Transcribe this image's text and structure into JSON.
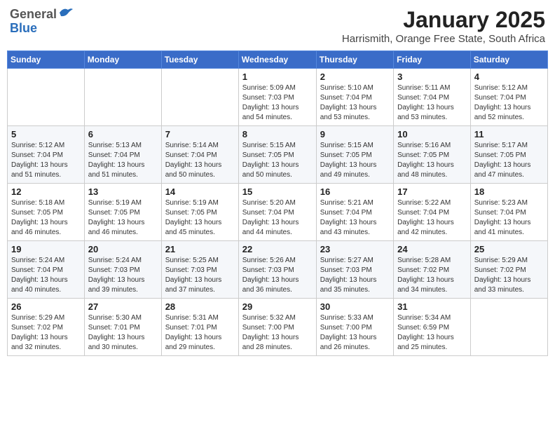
{
  "header": {
    "logo_general": "General",
    "logo_blue": "Blue",
    "month_title": "January 2025",
    "location": "Harrismith, Orange Free State, South Africa"
  },
  "weekdays": [
    "Sunday",
    "Monday",
    "Tuesday",
    "Wednesday",
    "Thursday",
    "Friday",
    "Saturday"
  ],
  "weeks": [
    [
      {
        "day": "",
        "info": ""
      },
      {
        "day": "",
        "info": ""
      },
      {
        "day": "",
        "info": ""
      },
      {
        "day": "1",
        "info": "Sunrise: 5:09 AM\nSunset: 7:03 PM\nDaylight: 13 hours\nand 54 minutes."
      },
      {
        "day": "2",
        "info": "Sunrise: 5:10 AM\nSunset: 7:04 PM\nDaylight: 13 hours\nand 53 minutes."
      },
      {
        "day": "3",
        "info": "Sunrise: 5:11 AM\nSunset: 7:04 PM\nDaylight: 13 hours\nand 53 minutes."
      },
      {
        "day": "4",
        "info": "Sunrise: 5:12 AM\nSunset: 7:04 PM\nDaylight: 13 hours\nand 52 minutes."
      }
    ],
    [
      {
        "day": "5",
        "info": "Sunrise: 5:12 AM\nSunset: 7:04 PM\nDaylight: 13 hours\nand 51 minutes."
      },
      {
        "day": "6",
        "info": "Sunrise: 5:13 AM\nSunset: 7:04 PM\nDaylight: 13 hours\nand 51 minutes."
      },
      {
        "day": "7",
        "info": "Sunrise: 5:14 AM\nSunset: 7:04 PM\nDaylight: 13 hours\nand 50 minutes."
      },
      {
        "day": "8",
        "info": "Sunrise: 5:15 AM\nSunset: 7:05 PM\nDaylight: 13 hours\nand 50 minutes."
      },
      {
        "day": "9",
        "info": "Sunrise: 5:15 AM\nSunset: 7:05 PM\nDaylight: 13 hours\nand 49 minutes."
      },
      {
        "day": "10",
        "info": "Sunrise: 5:16 AM\nSunset: 7:05 PM\nDaylight: 13 hours\nand 48 minutes."
      },
      {
        "day": "11",
        "info": "Sunrise: 5:17 AM\nSunset: 7:05 PM\nDaylight: 13 hours\nand 47 minutes."
      }
    ],
    [
      {
        "day": "12",
        "info": "Sunrise: 5:18 AM\nSunset: 7:05 PM\nDaylight: 13 hours\nand 46 minutes."
      },
      {
        "day": "13",
        "info": "Sunrise: 5:19 AM\nSunset: 7:05 PM\nDaylight: 13 hours\nand 46 minutes."
      },
      {
        "day": "14",
        "info": "Sunrise: 5:19 AM\nSunset: 7:05 PM\nDaylight: 13 hours\nand 45 minutes."
      },
      {
        "day": "15",
        "info": "Sunrise: 5:20 AM\nSunset: 7:04 PM\nDaylight: 13 hours\nand 44 minutes."
      },
      {
        "day": "16",
        "info": "Sunrise: 5:21 AM\nSunset: 7:04 PM\nDaylight: 13 hours\nand 43 minutes."
      },
      {
        "day": "17",
        "info": "Sunrise: 5:22 AM\nSunset: 7:04 PM\nDaylight: 13 hours\nand 42 minutes."
      },
      {
        "day": "18",
        "info": "Sunrise: 5:23 AM\nSunset: 7:04 PM\nDaylight: 13 hours\nand 41 minutes."
      }
    ],
    [
      {
        "day": "19",
        "info": "Sunrise: 5:24 AM\nSunset: 7:04 PM\nDaylight: 13 hours\nand 40 minutes."
      },
      {
        "day": "20",
        "info": "Sunrise: 5:24 AM\nSunset: 7:03 PM\nDaylight: 13 hours\nand 39 minutes."
      },
      {
        "day": "21",
        "info": "Sunrise: 5:25 AM\nSunset: 7:03 PM\nDaylight: 13 hours\nand 37 minutes."
      },
      {
        "day": "22",
        "info": "Sunrise: 5:26 AM\nSunset: 7:03 PM\nDaylight: 13 hours\nand 36 minutes."
      },
      {
        "day": "23",
        "info": "Sunrise: 5:27 AM\nSunset: 7:03 PM\nDaylight: 13 hours\nand 35 minutes."
      },
      {
        "day": "24",
        "info": "Sunrise: 5:28 AM\nSunset: 7:02 PM\nDaylight: 13 hours\nand 34 minutes."
      },
      {
        "day": "25",
        "info": "Sunrise: 5:29 AM\nSunset: 7:02 PM\nDaylight: 13 hours\nand 33 minutes."
      }
    ],
    [
      {
        "day": "26",
        "info": "Sunrise: 5:29 AM\nSunset: 7:02 PM\nDaylight: 13 hours\nand 32 minutes."
      },
      {
        "day": "27",
        "info": "Sunrise: 5:30 AM\nSunset: 7:01 PM\nDaylight: 13 hours\nand 30 minutes."
      },
      {
        "day": "28",
        "info": "Sunrise: 5:31 AM\nSunset: 7:01 PM\nDaylight: 13 hours\nand 29 minutes."
      },
      {
        "day": "29",
        "info": "Sunrise: 5:32 AM\nSunset: 7:00 PM\nDaylight: 13 hours\nand 28 minutes."
      },
      {
        "day": "30",
        "info": "Sunrise: 5:33 AM\nSunset: 7:00 PM\nDaylight: 13 hours\nand 26 minutes."
      },
      {
        "day": "31",
        "info": "Sunrise: 5:34 AM\nSunset: 6:59 PM\nDaylight: 13 hours\nand 25 minutes."
      },
      {
        "day": "",
        "info": ""
      }
    ]
  ]
}
